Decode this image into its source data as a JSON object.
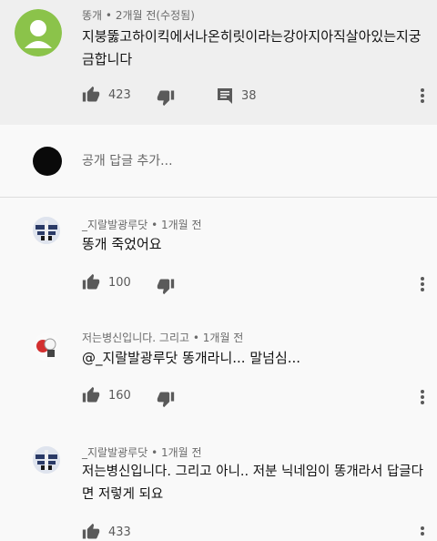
{
  "main_comment": {
    "author": "똥개",
    "time": "2개월 전(수정됨)",
    "text_line1": "지붕뚫고하이킥에서나온히릿이라는강아지아직살아있는지궁",
    "text_line2": "금합니다",
    "likes": "423",
    "replies": "38"
  },
  "reply_input": {
    "placeholder": "공개 답글 추가..."
  },
  "replies": [
    {
      "author": "_지랄발광루닷",
      "time": "1개월 전",
      "text_line1": "똥개 죽었어요",
      "likes": "100"
    },
    {
      "author": "저는병신입니다. 그리고",
      "time": "1개월 전",
      "text_line1": "@_지랄발광루닷 똥개라니... 말넘심...",
      "likes": "160"
    },
    {
      "author": "_지랄발광루닷",
      "time": "1개월 전",
      "text_line1": "저는병신입니다. 그리고 아니.. 저분 닉네임이 똥개라서 답글다",
      "text_line2": "면 저렇게 되요",
      "likes": "433"
    }
  ],
  "colors": {
    "avatar_green": "#8bc34a",
    "icon_gray": "#5a5a5a"
  }
}
